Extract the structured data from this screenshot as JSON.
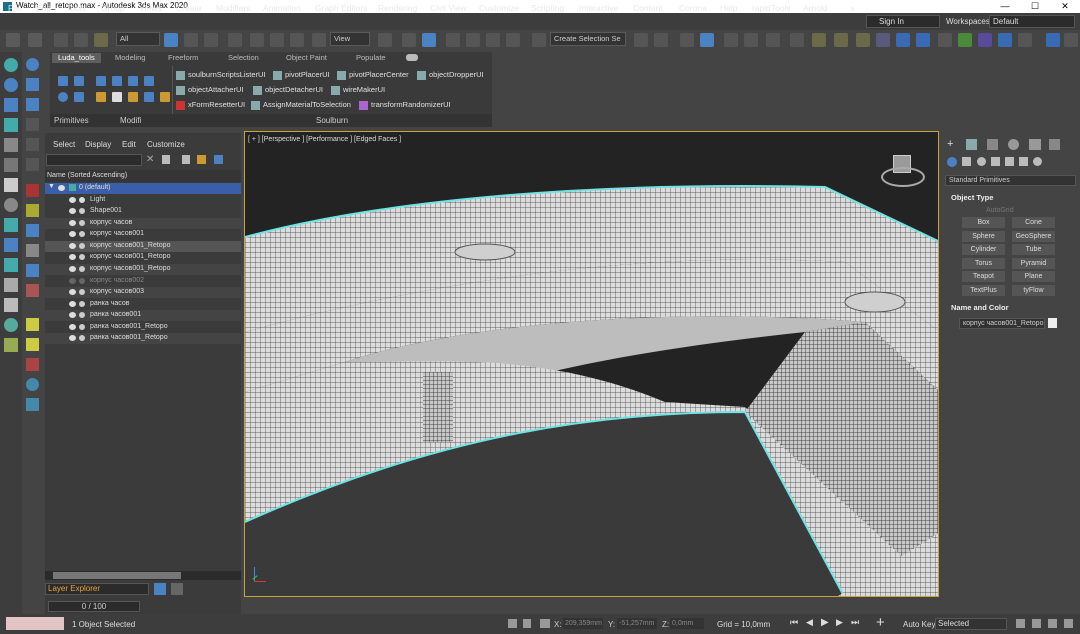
{
  "app": {
    "title": "Watch_all_retopo.max - Autodesk 3ds Max 2020"
  },
  "menu": [
    "File",
    "Edit",
    "Tools",
    "Group",
    "Views",
    "Create",
    "Modifiers",
    "Animation",
    "Graph Editors",
    "Rendering",
    "Civil View",
    "Customize",
    "Scripting",
    "Interactive",
    "Content",
    "Corona",
    "Help",
    "rapidTools",
    "Arnold"
  ],
  "signin": "Sign In",
  "workspaces_label": "Workspaces:",
  "workspace": "Default",
  "toolbar": {
    "filter": "All",
    "ref_coord": "View",
    "selection_set": "Create Selection Se"
  },
  "ribbon": {
    "tabs": [
      "Luda_tools",
      "Modeling",
      "Freeform",
      "Selection",
      "Object Paint",
      "Populate"
    ],
    "groups": [
      "Primitives",
      "Modifi",
      "Soulburn"
    ],
    "links": [
      "soulburnScriptsListerUI",
      "pivotPlacerUI",
      "pivotPlacerCenter",
      "objectDropperUI",
      "objectAttacherUI",
      "objectDetacherUI",
      "wireMakerUI",
      "xFormResetterUI",
      "AssignMaterialToSelection",
      "transformRandomizerUI"
    ]
  },
  "explorer": {
    "tabs": [
      "Select",
      "Display",
      "Edit",
      "Customize"
    ],
    "column": "Name (Sorted Ascending)",
    "rows": [
      "0 (default)",
      "Light",
      "Shape001",
      "корпус часов",
      "корпус часов001",
      "корпус часов001_Retopo",
      "корпус часов001_Retopo",
      "корпус часов001_Retopo",
      "корпус часов002",
      "корпус часов003",
      "ранка часов",
      "ранка часов001",
      "ранка часов001_Retopo",
      "ранка часов001_Retopo"
    ],
    "footer": "Layer Explorer",
    "frame": "0 / 100"
  },
  "viewport": {
    "label": "[ + ] [Perspective ] [Performance ] [Edged Faces ]"
  },
  "cmd": {
    "rollout": "Standard Primitives",
    "object_type": "Object Type",
    "autogrid": "AutoGrid",
    "buttons": [
      "Box",
      "Cone",
      "Sphere",
      "GeoSphere",
      "Cylinder",
      "Tube",
      "Torus",
      "Pyramid",
      "Teapot",
      "Plane",
      "TextPlus",
      "tyFlow"
    ],
    "name_color": "Name and Color",
    "object_name": "корпус часов001_Retopo"
  },
  "status": {
    "selected": "1 Object Selected",
    "x_label": "X:",
    "x": "209,359mm",
    "y_label": "Y:",
    "y": "-51,257mm",
    "z_label": "Z:",
    "z": "0,0mm",
    "grid": "Grid = 10,0mm",
    "autokey": "Auto Key",
    "setkey_mode": "Selected"
  }
}
